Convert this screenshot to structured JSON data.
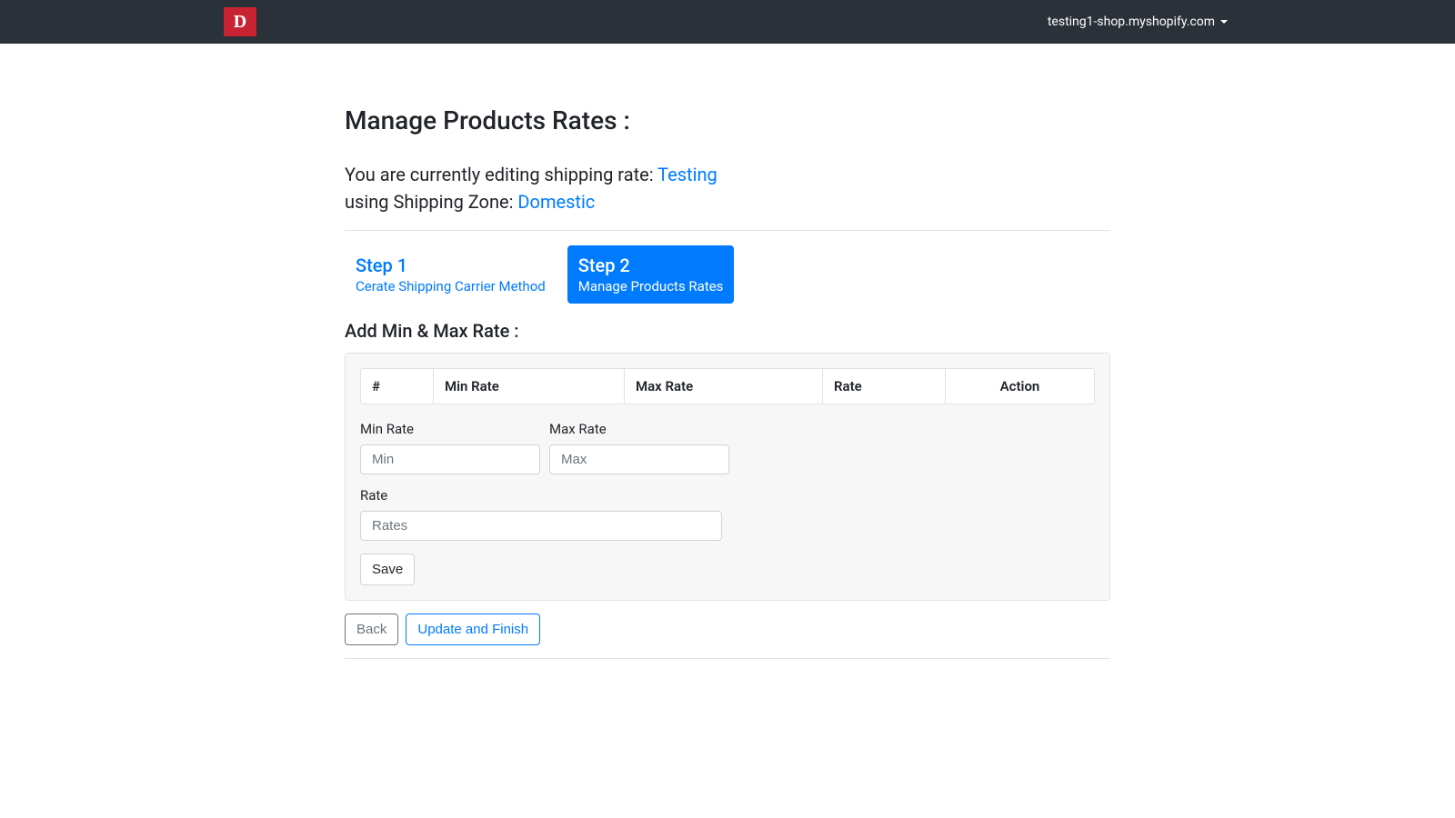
{
  "navbar": {
    "logo_letter": "D",
    "domain": "testing1-shop.myshopify.com"
  },
  "page": {
    "title": "Manage Products Rates :",
    "editing_prefix": "You are currently editing shipping rate: ",
    "rate_name": "Testing",
    "zone_prefix": "using Shipping Zone: ",
    "zone_name": "Domestic"
  },
  "steps": [
    {
      "title": "Step 1",
      "sub": "Cerate Shipping Carrier Method",
      "active": false
    },
    {
      "title": "Step 2",
      "sub": "Manage Products Rates",
      "active": true
    }
  ],
  "section": {
    "title": "Add Min & Max Rate :"
  },
  "table": {
    "headers": [
      "#",
      "Min Rate",
      "Max Rate",
      "Rate",
      "Action"
    ]
  },
  "form": {
    "min_label": "Min Rate",
    "min_placeholder": "Min",
    "max_label": "Max Rate",
    "max_placeholder": "Max",
    "rate_label": "Rate",
    "rate_placeholder": "Rates",
    "save_label": "Save"
  },
  "footer": {
    "back_label": "Back",
    "finish_label": "Update and Finish"
  }
}
